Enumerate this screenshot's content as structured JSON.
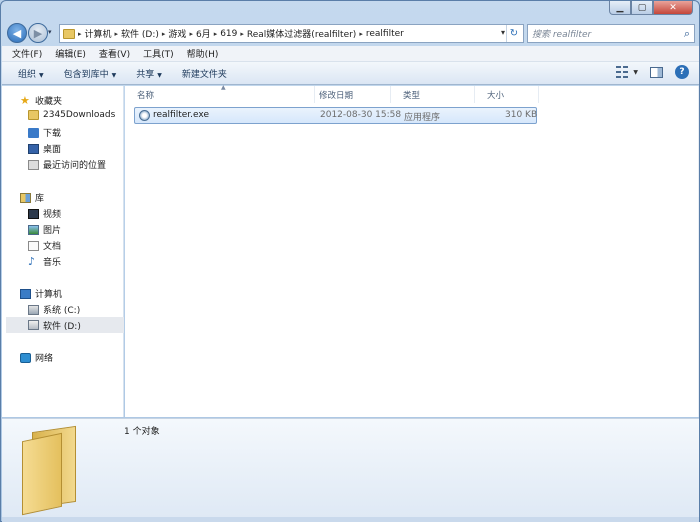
{
  "window": {
    "caption_buttons": {
      "minimize": "▁",
      "maximize": "▢",
      "close": "✕"
    }
  },
  "nav": {
    "back_icon": "◀",
    "forward_icon": "▶",
    "dropdown_icon": "▾"
  },
  "address": {
    "sep": "▸",
    "crumbs": [
      "计算机",
      "软件 (D:)",
      "游戏",
      "6月",
      "619",
      "Real媒体过滤器(realfilter)",
      "realfilter"
    ],
    "dropdown_icon": "▾",
    "refresh_icon": "↻"
  },
  "search": {
    "placeholder": "搜索 realfilter",
    "icon": "⌕"
  },
  "menubar": [
    "文件(F)",
    "编辑(E)",
    "查看(V)",
    "工具(T)",
    "帮助(H)"
  ],
  "toolbar": {
    "organize": "组织",
    "include": "包含到库中",
    "share": "共享",
    "new_folder": "新建文件夹",
    "arrow": "▼",
    "help_icon": "?"
  },
  "navpane": {
    "favorites": "收藏夹",
    "fav_items": [
      "2345Downloads",
      "下载",
      "桌面",
      "最近访问的位置"
    ],
    "libraries": "库",
    "lib_items": [
      "视频",
      "图片",
      "文档",
      "音乐"
    ],
    "computer": "计算机",
    "drives": [
      "系统 (C:)",
      "软件 (D:)"
    ],
    "network": "网络"
  },
  "columns": {
    "name": "名称",
    "modified": "修改日期",
    "type": "类型",
    "size": "大小",
    "sort_indicator": "▲"
  },
  "files": [
    {
      "name": "realfilter.exe",
      "modified": "2012-08-30 15:58",
      "type": "应用程序",
      "size": "310 KB"
    }
  ],
  "details": {
    "count": "1 个对象"
  },
  "colors": {
    "selection": "#d6e7fb",
    "accent": "#2c6fb7"
  }
}
